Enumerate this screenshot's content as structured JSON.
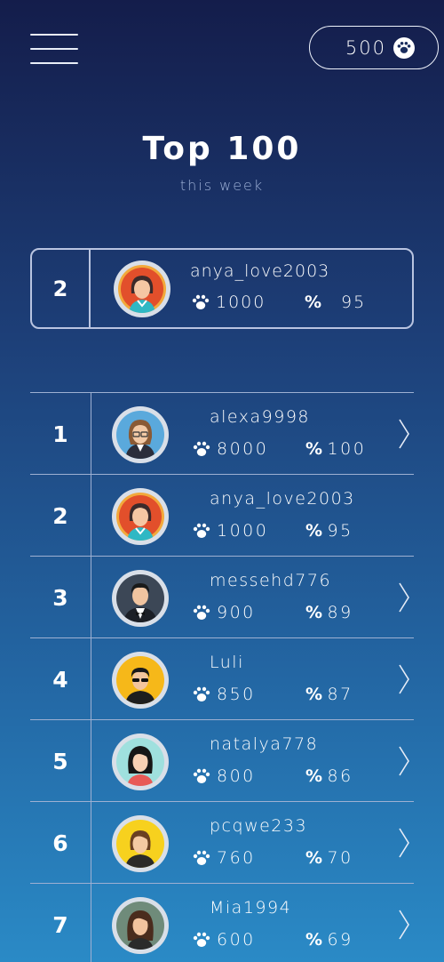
{
  "header": {
    "coins": "500",
    "title": "Top 100",
    "subtitle": "this week"
  },
  "my_entry": {
    "rank": "2",
    "username": "anya_love2003",
    "score": "1000",
    "percent": "95",
    "avatar": "girl-orange-avatar"
  },
  "leaderboard": [
    {
      "rank": "1",
      "username": "alexa9998",
      "score": "8000",
      "percent": "100",
      "avatar": "woman-glasses-avatar",
      "has_chevron": true
    },
    {
      "rank": "2",
      "username": "anya_love2003",
      "score": "1000",
      "percent": "95",
      "avatar": "girl-orange-avatar",
      "has_chevron": false
    },
    {
      "rank": "3",
      "username": "messehd776",
      "score": "900",
      "percent": "89",
      "avatar": "man-bowtie-avatar",
      "has_chevron": true
    },
    {
      "rank": "4",
      "username": "Luli",
      "score": "850",
      "percent": "87",
      "avatar": "man-sunglasses-avatar",
      "has_chevron": true
    },
    {
      "rank": "5",
      "username": "natalya778",
      "score": "800",
      "percent": "86",
      "avatar": "woman-black-hair-avatar",
      "has_chevron": true
    },
    {
      "rank": "6",
      "username": "pcqwe233",
      "score": "760",
      "percent": "70",
      "avatar": "woman-yellow-avatar",
      "has_chevron": true
    },
    {
      "rank": "7",
      "username": "Mia1994",
      "score": "600",
      "percent": "69",
      "avatar": "woman-brown-hair-avatar",
      "has_chevron": true
    }
  ],
  "icons": {
    "menu": "hamburger-icon",
    "coin": "paw-icon",
    "score": "paw-icon",
    "percent": "percent-icon",
    "row_action": "chevron-right-icon"
  },
  "colors": {
    "bg_top": "#141d4b",
    "bg_bottom": "#2a8ac6",
    "divider": "#9eb0d2"
  }
}
